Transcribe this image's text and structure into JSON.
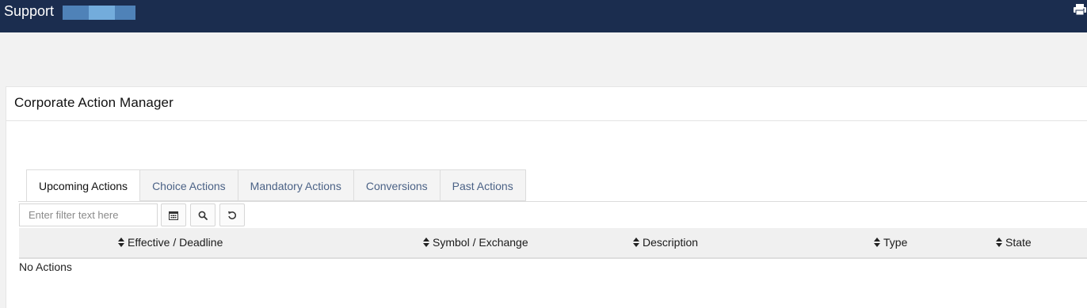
{
  "header": {
    "app_title": "Support",
    "account_blocks": [
      "#4f82b8",
      "#73acdc",
      "#4f82b8"
    ],
    "print_icon": "print-icon"
  },
  "panel": {
    "title": "Corporate Action Manager"
  },
  "tabs": [
    {
      "label": "Upcoming Actions",
      "active": true
    },
    {
      "label": "Choice Actions",
      "active": false
    },
    {
      "label": "Mandatory Actions",
      "active": false
    },
    {
      "label": "Conversions",
      "active": false
    },
    {
      "label": "Past Actions",
      "active": false
    }
  ],
  "toolbar": {
    "filter_placeholder": "Enter filter text here",
    "filter_value": "",
    "buttons": [
      "calendar-icon",
      "search-icon",
      "refresh-icon"
    ]
  },
  "table": {
    "columns": [
      "Effective / Deadline",
      "Symbol / Exchange",
      "Description",
      "Type",
      "State"
    ],
    "sort_icon": "sort-icon",
    "empty_message": "No Actions"
  },
  "colors": {
    "topbar": "#1b2d4f",
    "tab_text": "#4b6286",
    "header_bg": "#f0f0f0"
  }
}
